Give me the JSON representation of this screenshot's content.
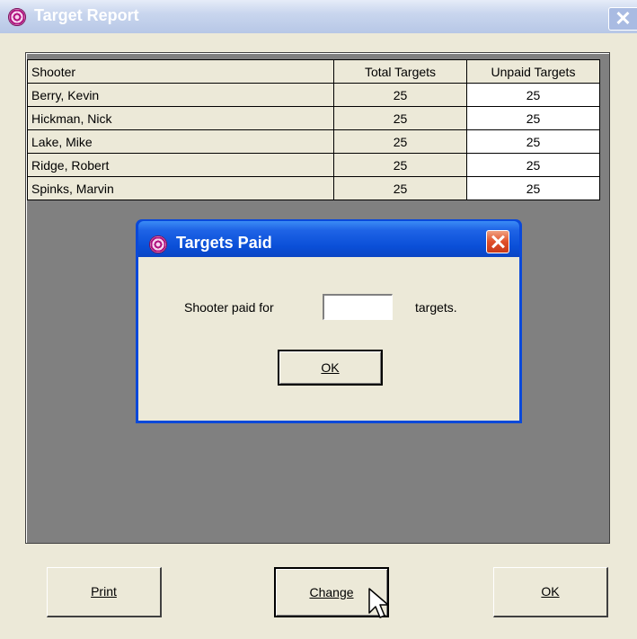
{
  "window": {
    "title": "Target Report",
    "close_glyph": "✕"
  },
  "table": {
    "headers": [
      "Shooter",
      "Total Targets",
      "Unpaid Targets"
    ],
    "rows": [
      {
        "shooter": "Berry, Kevin",
        "total": "25",
        "unpaid": "25"
      },
      {
        "shooter": "Hickman, Nick",
        "total": "25",
        "unpaid": "25"
      },
      {
        "shooter": "Lake, Mike",
        "total": "25",
        "unpaid": "25"
      },
      {
        "shooter": "Ridge, Robert",
        "total": "25",
        "unpaid": "25"
      },
      {
        "shooter": "Spinks, Marvin",
        "total": "25",
        "unpaid": "25"
      }
    ]
  },
  "dialog": {
    "title": "Targets Paid",
    "prompt": "Shooter paid for",
    "input_value": "",
    "suffix": "targets.",
    "ok_label": "OK"
  },
  "buttons": {
    "print": "Print",
    "change": "Change",
    "ok": "OK"
  },
  "colors": {
    "titlebar_blue": "#0a4fd8",
    "window_face": "#ece9d8",
    "panel_gray": "#808080",
    "icon_magenta": "#b0127f"
  },
  "icons": {
    "app_icon": "target-icon",
    "cursor": "mouse-pointer-icon"
  }
}
